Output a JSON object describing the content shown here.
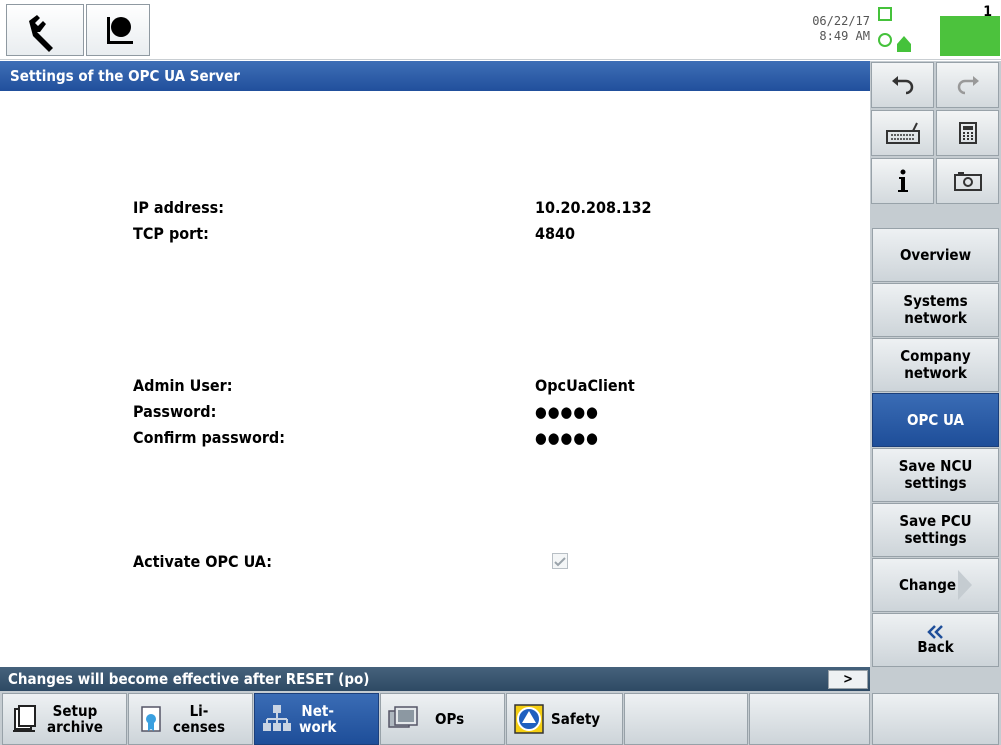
{
  "header": {
    "date": "06/22/17",
    "time": "8:49 AM",
    "alarm_count": "1"
  },
  "title": "Settings of the OPC UA Server",
  "fields": {
    "ip_label": "IP address:",
    "ip_value": "10.20.208.132",
    "tcp_label": "TCP port:",
    "tcp_value": "4840",
    "admin_label": "Admin User:",
    "admin_value": "OpcUaClient",
    "password_label": "Password:",
    "password_value": "●●●●●",
    "confirm_label": "Confirm password:",
    "confirm_value": "●●●●●",
    "activate_label": "Activate OPC UA:",
    "activate_checked": true
  },
  "message": "Changes will become effective after RESET (po)",
  "scroll_label": ">",
  "vertical_softkeys": {
    "overview": "Overview",
    "systems_network_1": "Systems",
    "systems_network_2": "network",
    "company_network_1": "Company",
    "company_network_2": "network",
    "opc_ua": "OPC UA",
    "save_ncu_1": "Save NCU",
    "save_ncu_2": "settings",
    "save_pcu_1": "Save PCU",
    "save_pcu_2": "settings",
    "change": "Change",
    "back": "Back"
  },
  "horizontal_softkeys": {
    "setup_1": "Setup",
    "setup_2": "archive",
    "licenses_1": "Li-",
    "licenses_2": "censes",
    "network_1": "Net-",
    "network_2": "work",
    "ops": "OPs",
    "safety": "Safety"
  },
  "colors": {
    "title_bar": "#2a59a6",
    "active_softkey": "#2a5aa8",
    "message_bar": "#3a566f"
  }
}
